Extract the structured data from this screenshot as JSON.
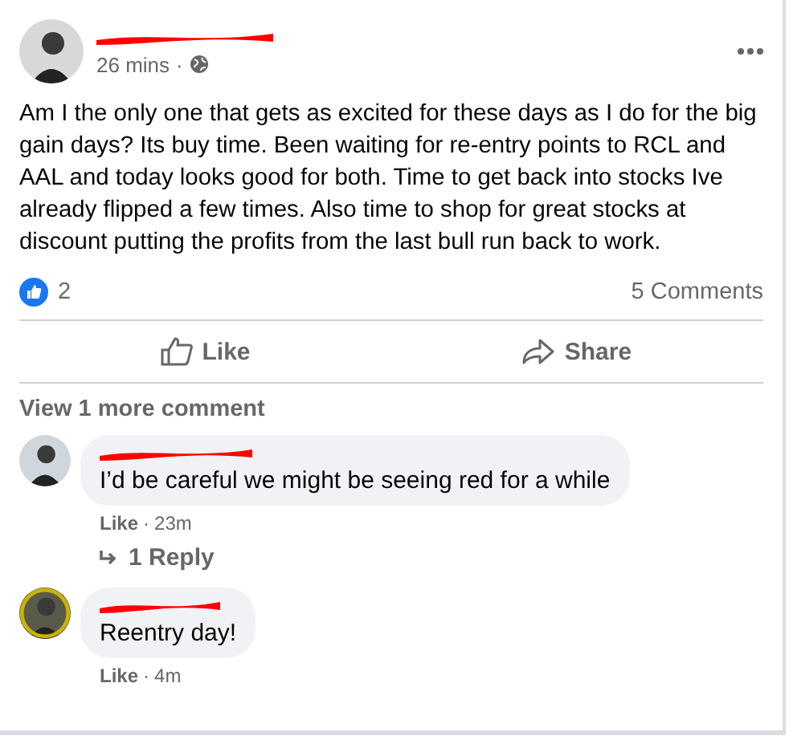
{
  "post": {
    "time": "26 mins",
    "separator": "·",
    "text": "Am I the only one that gets as excited for these days as I do for the big gain days? Its buy time. Been waiting for re-entry points to RCL and AAL and today looks good for both. Time to get back into stocks Ive already flipped a few times. Also time to shop for great stocks at discount putting the profits from the last bull run back to work.",
    "reaction_count": "2",
    "comment_count": "5 Comments"
  },
  "actions": [
    {
      "label": "Like",
      "kind": "like"
    },
    {
      "label": "Share",
      "kind": "share"
    }
  ],
  "view_more": "View 1 more comment",
  "comments": [
    {
      "text": "I’d be careful we might be seeing red for a while",
      "like": "Like",
      "separator": "·",
      "time": "23m",
      "replies": "1 Reply",
      "avatar_ring": false
    },
    {
      "text": "Reentry day!",
      "like": "Like",
      "separator": "·",
      "time": "4m",
      "avatar_ring": true
    }
  ]
}
